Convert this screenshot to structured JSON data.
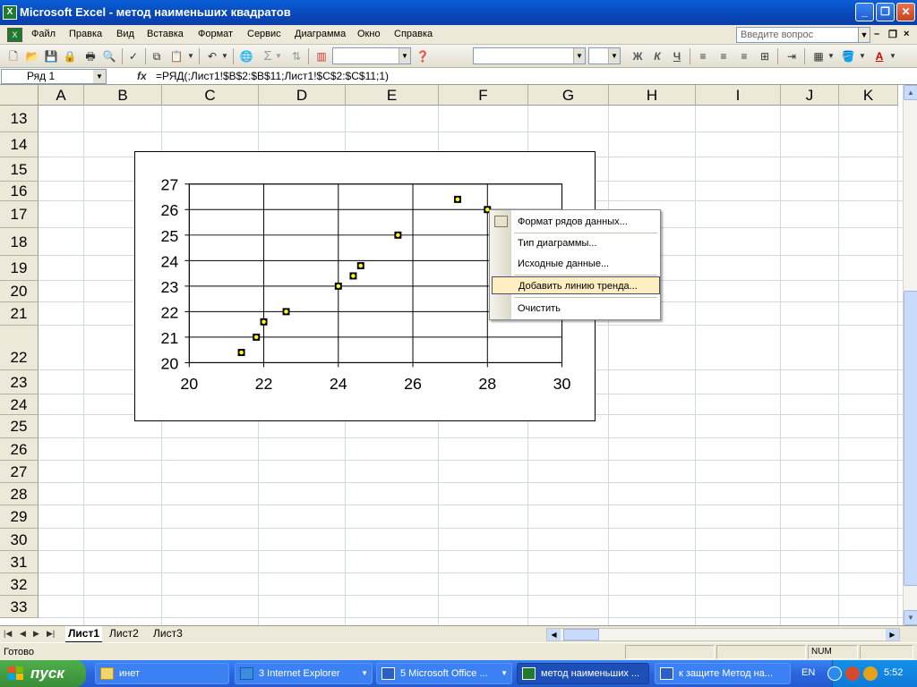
{
  "window": {
    "title": "Microsoft Excel - метод наименьших квадратов",
    "app_icon": "excel-icon",
    "controls": [
      "minimize-icon",
      "restore-icon",
      "close-icon"
    ]
  },
  "menu": {
    "items": [
      "Файл",
      "Правка",
      "Вид",
      "Вставка",
      "Формат",
      "Сервис",
      "Диаграмма",
      "Окно",
      "Справка"
    ],
    "help_placeholder": "Введите вопрос",
    "doc_close": "×"
  },
  "toolbar": {
    "buttons": [
      "new-icon",
      "open-icon",
      "save-icon",
      "permission-icon",
      "print-icon",
      "print-preview-icon",
      "spelling-icon",
      "copy-icon",
      "paste-icon",
      "undo-icon",
      "hyperlink-icon",
      "autosum-icon",
      "sort-icon",
      "chart-wizard-icon",
      "help-icon"
    ],
    "autosum_glyph": "Σ",
    "bold": "Ж",
    "italic": "К",
    "underline": "Ч"
  },
  "formula_bar": {
    "name_box": "Ряд 1",
    "fx_label": "fx",
    "formula": "=РЯД(;Лист1!$B$2:$B$11;Лист1!$C$2:$C$11;1)"
  },
  "sheet": {
    "columns": [
      "A",
      "B",
      "C",
      "D",
      "E",
      "F",
      "G",
      "H",
      "I",
      "J",
      "K"
    ],
    "rows": [
      "13",
      "14",
      "15",
      "16",
      "17",
      "18",
      "19",
      "20",
      "21",
      "22",
      "23",
      "24",
      "25",
      "26",
      "27",
      "28",
      "29",
      "30",
      "31",
      "32",
      "33"
    ]
  },
  "chart_data": {
    "type": "scatter",
    "x": [
      21.4,
      21.8,
      22.0,
      22.6,
      24.0,
      24.4,
      24.6,
      25.6,
      27.2,
      28.0
    ],
    "y": [
      20.4,
      21.0,
      21.6,
      22.0,
      23.0,
      23.4,
      23.8,
      25.0,
      26.4,
      26.0
    ],
    "xlim": [
      20,
      30
    ],
    "ylim": [
      20,
      27
    ],
    "x_ticks": [
      "20",
      "22",
      "24",
      "26",
      "28",
      "30"
    ],
    "y_ticks": [
      "20",
      "21",
      "22",
      "23",
      "24",
      "25",
      "26",
      "27"
    ],
    "grid": true,
    "marker_fill": "#ffff00",
    "title": "",
    "xlabel": "",
    "ylabel": ""
  },
  "context_menu": {
    "items": [
      {
        "label": "Формат рядов данных...",
        "icon": "format-series-icon"
      },
      {
        "label": "Тип диаграммы..."
      },
      {
        "label": "Исходные данные..."
      },
      {
        "label": "Добавить линию тренда...",
        "highlighted": true
      },
      {
        "label": "Очистить"
      }
    ]
  },
  "sheet_tabs": {
    "tabs": [
      "Лист1",
      "Лист2",
      "Лист3"
    ],
    "active": "Лист1"
  },
  "status": {
    "ready": "Готово",
    "num": "NUM"
  },
  "taskbar": {
    "start_label": "пуск",
    "tasks": [
      "инет",
      "3 Internet Explorer",
      "5 Microsoft Office ...",
      "метод наименьших ...",
      "к защите Метод на..."
    ],
    "active_task": "метод наименьших ...",
    "language": "EN",
    "clock": "5:52"
  }
}
